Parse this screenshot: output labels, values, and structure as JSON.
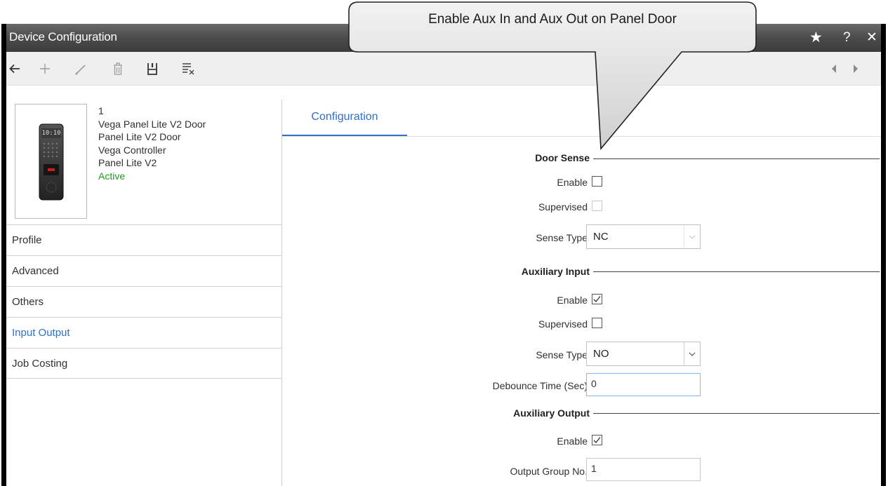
{
  "window": {
    "title": "Device Configuration"
  },
  "title_controls": {
    "star": "★",
    "help": "?",
    "close": "✕"
  },
  "toolbar": {
    "back_icon": "arrow-left-icon",
    "add_icon": "plus-icon",
    "edit_icon": "pencil-icon",
    "delete_icon": "trash-icon",
    "save_icon": "save-icon",
    "clear_icon": "clear-list-icon",
    "prev_icon": "chevron-left-icon",
    "next_icon": "chevron-right-icon"
  },
  "device": {
    "screen_text": "10:10",
    "id": "1",
    "name": "Vega Panel Lite V2 Door",
    "model": "Panel Lite V2 Door",
    "controller": "Vega Controller",
    "type": "Panel Lite V2",
    "status": "Active"
  },
  "nav": {
    "items": [
      {
        "label": "Profile"
      },
      {
        "label": "Advanced"
      },
      {
        "label": "Others"
      },
      {
        "label": "Input Output"
      },
      {
        "label": "Job Costing"
      }
    ],
    "selected": "Input Output"
  },
  "tabs": [
    {
      "label": "Configuration"
    }
  ],
  "door_sense": {
    "title": "Door Sense",
    "enable_label": "Enable",
    "enable": false,
    "supervised_label": "Supervised",
    "supervised": false,
    "supervised_disabled": true,
    "sense_type_label": "Sense Type",
    "sense_type": "NC"
  },
  "aux_input": {
    "title": "Auxiliary Input",
    "enable_label": "Enable",
    "enable": true,
    "supervised_label": "Supervised",
    "supervised": false,
    "sense_type_label": "Sense Type",
    "sense_type": "NO",
    "debounce_label": "Debounce Time (Sec)",
    "debounce": "0"
  },
  "aux_output": {
    "title": "Auxiliary Output",
    "enable_label": "Enable",
    "enable": true,
    "group_label": "Output Group No.",
    "group": "1"
  },
  "callout": {
    "text": "Enable Aux In and Aux Out on Panel Door"
  },
  "colors": {
    "accent": "#2f6fc8",
    "active": "#1e9a1e",
    "titlebar": "#4b4b4b"
  }
}
